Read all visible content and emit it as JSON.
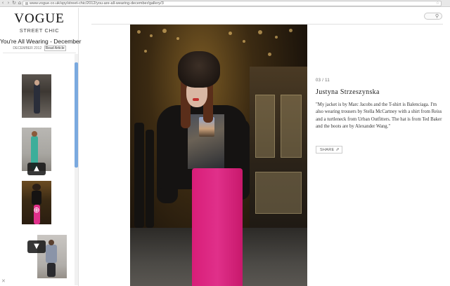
{
  "browser": {
    "url": "www.vogue.co.uk/spy/street-chic/2012/you-are-all-wearing-december/gallery/3",
    "back_icon": "back-arrow-icon",
    "forward_icon": "forward-arrow-icon",
    "home_icon": "home-icon",
    "bookmark_icon": "star-icon"
  },
  "sidebar": {
    "logo": "VOGUE",
    "section": "STREET CHIC",
    "gallery_title": "You're All Wearing - December",
    "date": "DECEMBER 2012",
    "read_article": "Read Article",
    "up_arrow": "▲",
    "down_arrow": "▼",
    "zoom_glyph": "⊕",
    "close_glyph": "✕"
  },
  "main": {
    "counter": "03 / 11",
    "name": "Justyna Strzeszynska",
    "quote": "\"My jacket is by Marc Jacobs and the T-shirt is Balenciaga. I'm also wearing trousers by Stella McCartney with a shirt from Reiss and a turtleneck from Urban Outfitters. The hat is from Ted Baker and the boots are by Alexander Wang.\"",
    "share_label": "SHARE",
    "share_icon": "share-icon",
    "search_icon": "search-icon"
  },
  "colors": {
    "scroll_accent": "#7aa9df",
    "trousers": "#e0308a"
  }
}
